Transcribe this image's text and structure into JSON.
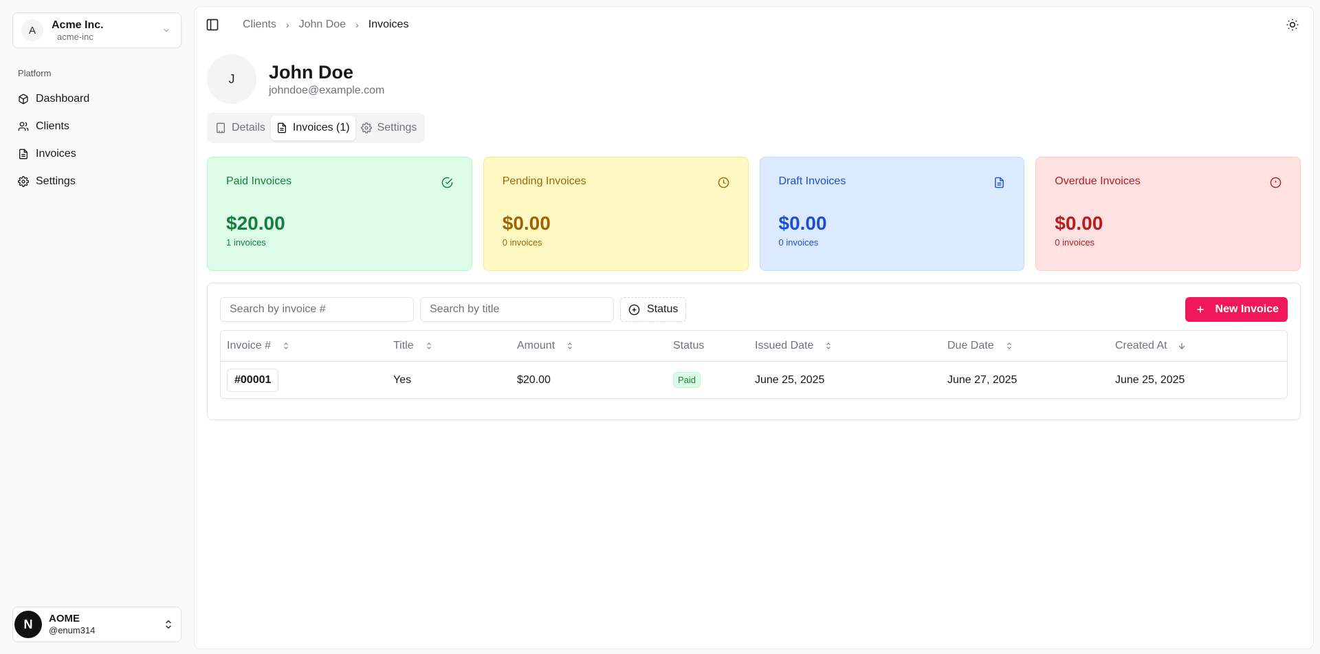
{
  "org": {
    "initial": "A",
    "name": "Acme Inc.",
    "slug": "acme-inc"
  },
  "nav": {
    "group_label": "Platform",
    "items": [
      {
        "label": "Dashboard",
        "icon": "box-icon"
      },
      {
        "label": "Clients",
        "icon": "users-icon"
      },
      {
        "label": "Invoices",
        "icon": "file-text-icon"
      },
      {
        "label": "Settings",
        "icon": "gear-icon"
      }
    ]
  },
  "user": {
    "initial": "N",
    "name": "AOME",
    "handle": "@enum314"
  },
  "breadcrumb": [
    "Clients",
    "John Doe",
    "Invoices"
  ],
  "client": {
    "initial": "J",
    "name": "John Doe",
    "email": "johndoe@example.com"
  },
  "tabs": [
    {
      "label": "Details",
      "icon": "building-icon",
      "active": false
    },
    {
      "label": "Invoices (1)",
      "icon": "file-text-icon",
      "active": true
    },
    {
      "label": "Settings",
      "icon": "gear-icon",
      "active": false
    }
  ],
  "stats": [
    {
      "title": "Paid Invoices",
      "value": "$20.00",
      "count": "1 invoices",
      "icon": "check-circle-icon",
      "color": "#15803d"
    },
    {
      "title": "Pending Invoices",
      "value": "$0.00",
      "count": "0 invoices",
      "icon": "clock-icon",
      "color": "#a16207"
    },
    {
      "title": "Draft Invoices",
      "value": "$0.00",
      "count": "0 invoices",
      "icon": "file-text-icon",
      "color": "#1d4ed8"
    },
    {
      "title": "Overdue Invoices",
      "value": "$0.00",
      "count": "0 invoices",
      "icon": "alert-circle-icon",
      "color": "#b91c1c"
    }
  ],
  "toolbar": {
    "search_invoice_placeholder": "Search by invoice #",
    "search_title_placeholder": "Search by title",
    "status_label": "Status",
    "new_invoice_label": "New Invoice",
    "accent": "#f0185a"
  },
  "table": {
    "columns": [
      "Invoice #",
      "Title",
      "Amount",
      "Status",
      "Issued Date",
      "Due Date",
      "Created At"
    ],
    "rows": [
      {
        "invoice": "#00001",
        "title": "Yes",
        "amount": "$20.00",
        "status": "Paid",
        "issued": "June 25, 2025",
        "due": "June 27, 2025",
        "created": "June 25, 2025"
      }
    ]
  }
}
